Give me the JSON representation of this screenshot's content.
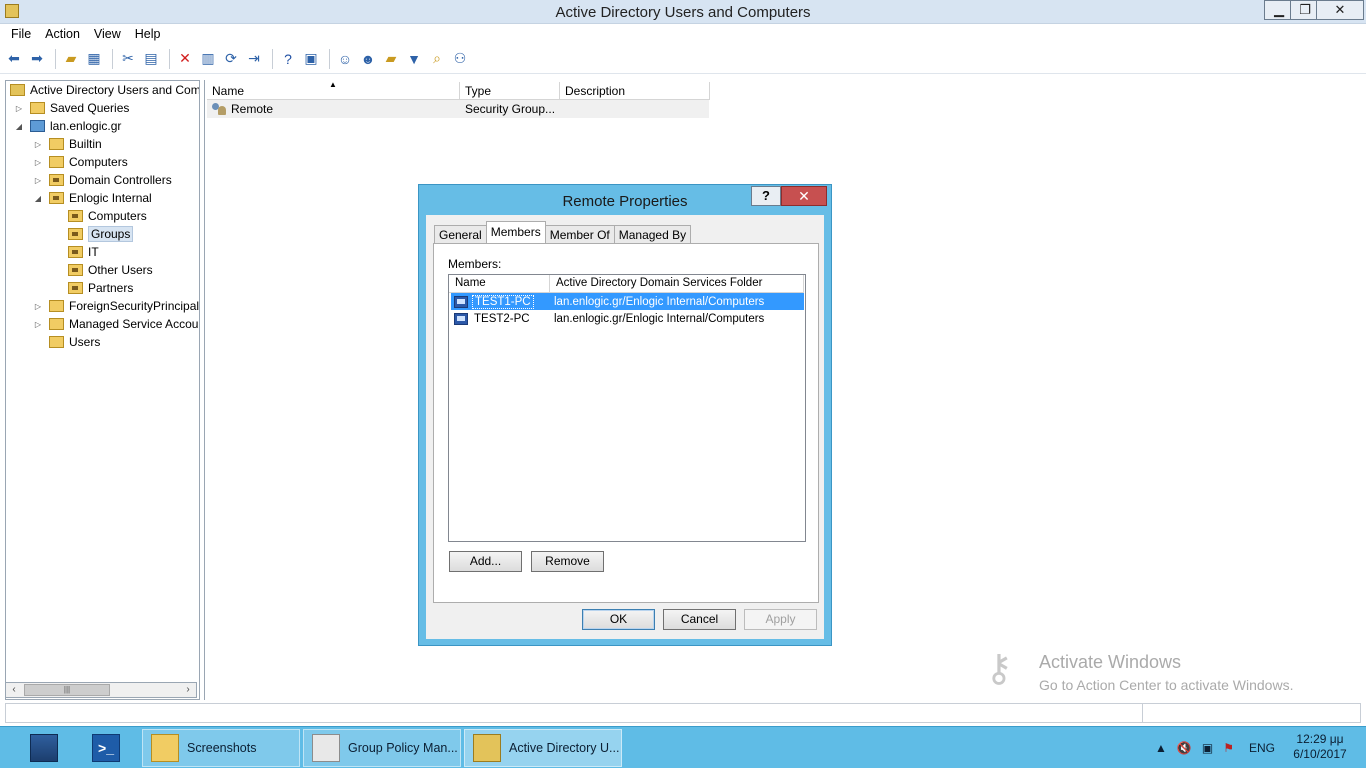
{
  "window": {
    "title": "Active Directory Users and Computers",
    "controls": {
      "minimize": "▁",
      "maximize": "❐",
      "close": "✕"
    }
  },
  "menu": [
    "File",
    "Action",
    "View",
    "Help"
  ],
  "toolbar": {
    "icons": [
      "back-arrow-icon",
      "forward-arrow-icon",
      "up-folder-icon",
      "show-hide-tree-icon",
      "cut-icon",
      "paste-icon",
      "delete-icon",
      "properties-icon",
      "refresh-icon",
      "export-list-icon",
      "help-icon",
      "mmc-icon",
      "new-user-icon",
      "new-group-icon",
      "new-ou-icon",
      "filter-icon",
      "find-icon",
      "add-to-group-icon"
    ]
  },
  "tree": {
    "items": [
      {
        "label": "Active Directory Users and Com",
        "expander": "",
        "icon": "root",
        "indent": 0
      },
      {
        "label": "Saved Queries",
        "expander": "▷",
        "icon": "folder",
        "indent": 1
      },
      {
        "label": "lan.enlogic.gr",
        "expander": "◢",
        "icon": "domain",
        "indent": 1
      },
      {
        "label": "Builtin",
        "expander": "▷",
        "icon": "folder",
        "indent": 2
      },
      {
        "label": "Computers",
        "expander": "▷",
        "icon": "folder",
        "indent": 2
      },
      {
        "label": "Domain Controllers",
        "expander": "▷",
        "icon": "ou",
        "indent": 2
      },
      {
        "label": "Enlogic Internal",
        "expander": "◢",
        "icon": "ou",
        "indent": 2
      },
      {
        "label": "Computers",
        "expander": "",
        "icon": "ou",
        "indent": 3
      },
      {
        "label": "Groups",
        "expander": "",
        "icon": "ou",
        "indent": 3,
        "selected": true
      },
      {
        "label": "IT",
        "expander": "",
        "icon": "ou",
        "indent": 3
      },
      {
        "label": "Other Users",
        "expander": "",
        "icon": "ou",
        "indent": 3
      },
      {
        "label": "Partners",
        "expander": "",
        "icon": "ou",
        "indent": 3
      },
      {
        "label": "ForeignSecurityPrincipals",
        "expander": "▷",
        "icon": "folder",
        "indent": 2
      },
      {
        "label": "Managed Service Accour",
        "expander": "▷",
        "icon": "folder",
        "indent": 2
      },
      {
        "label": "Users",
        "expander": "",
        "icon": "folder",
        "indent": 2
      }
    ],
    "scroll": {
      "left": "‹",
      "right": "›",
      "thumb": "|||"
    }
  },
  "list": {
    "columns": [
      "Name",
      "Type",
      "Description"
    ],
    "sort_indicator": "▲",
    "rows": [
      {
        "name": "Remote",
        "type": "Security Group...",
        "description": ""
      }
    ]
  },
  "dialog": {
    "title": "Remote Properties",
    "help": "?",
    "close": "✕",
    "tabs": [
      "General",
      "Members",
      "Member Of",
      "Managed By"
    ],
    "active_tab": "Members",
    "members_label": "Members:",
    "members_columns": [
      "Name",
      "Active Directory Domain Services Folder"
    ],
    "members": [
      {
        "name": "TEST1-PC",
        "folder": "lan.enlogic.gr/Enlogic Internal/Computers",
        "selected": true
      },
      {
        "name": "TEST2-PC",
        "folder": "lan.enlogic.gr/Enlogic Internal/Computers",
        "selected": false
      }
    ],
    "buttons": {
      "add": "Add...",
      "remove": "Remove",
      "ok": "OK",
      "cancel": "Cancel",
      "apply": "Apply"
    }
  },
  "watermark": {
    "line1": "Activate Windows",
    "line2": "Go to Action Center to activate Windows."
  },
  "taskbar": {
    "items": [
      {
        "label": "",
        "icon": "server-manager-icon"
      },
      {
        "label": "",
        "icon": "powershell-icon"
      },
      {
        "label": "Screenshots",
        "icon": "folder-icon"
      },
      {
        "label": "Group Policy Man...",
        "icon": "group-policy-icon"
      },
      {
        "label": "Active Directory U...",
        "icon": "active-directory-icon"
      }
    ],
    "tray": {
      "language": "ENG",
      "time": "12:29 μμ",
      "date": "6/10/2017"
    }
  },
  "colors": {
    "taskbar": "#5fbce6",
    "dialog_frame": "#66bde6",
    "selection": "#3399ff",
    "close_red": "#c75050"
  }
}
